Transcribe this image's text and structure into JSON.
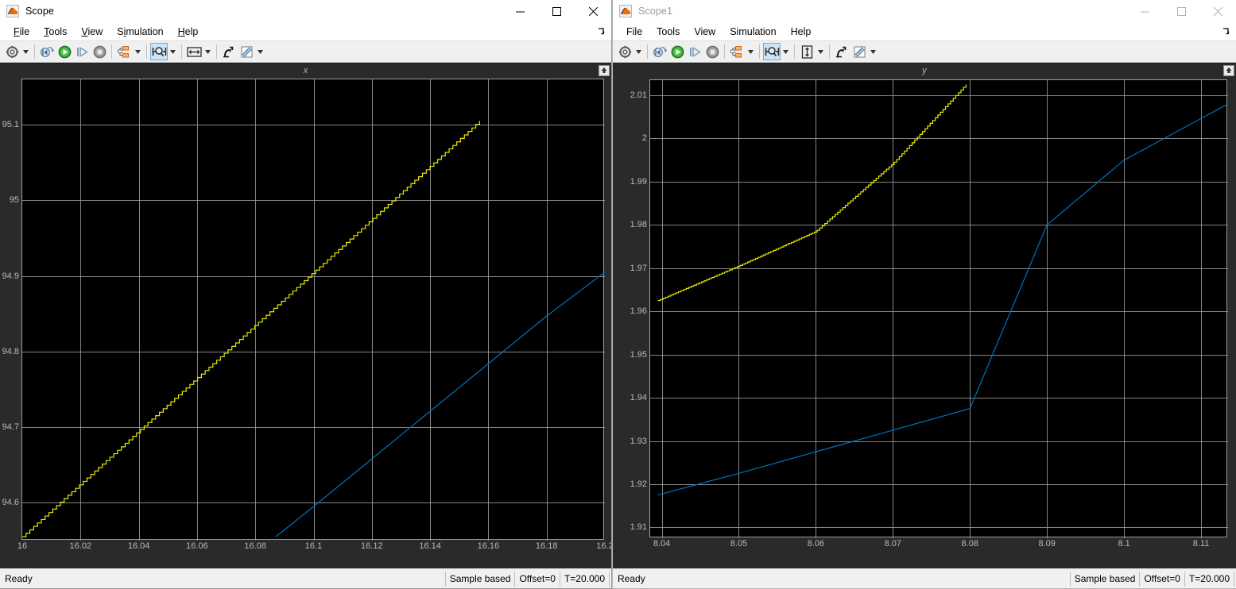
{
  "windows": [
    {
      "id": "scope",
      "title": "Scope",
      "active": true,
      "icon": "matlab-scope-icon",
      "menus": [
        {
          "label": "File",
          "mnemonic": "F"
        },
        {
          "label": "Tools",
          "mnemonic": "T"
        },
        {
          "label": "View",
          "mnemonic": "V"
        },
        {
          "label": "Simulation",
          "mnemonic": "i"
        },
        {
          "label": "Help",
          "mnemonic": "H"
        }
      ],
      "toolbar": [
        {
          "name": "print-options-button",
          "icon": "gear-icon",
          "dropdown": true
        },
        {
          "sep": true
        },
        {
          "name": "run-back-to-start-button",
          "icon": "rewind-icon"
        },
        {
          "name": "run-button",
          "icon": "play-icon"
        },
        {
          "name": "step-forward-button",
          "icon": "step-forward-icon"
        },
        {
          "name": "stop-button",
          "icon": "stop-icon"
        },
        {
          "sep": true
        },
        {
          "name": "configuration-properties-button",
          "icon": "layout-icon",
          "dropdown": true
        },
        {
          "sep": true
        },
        {
          "name": "zoom-in-x-button",
          "icon": "zoom-x-icon",
          "dropdown": true,
          "active": true
        },
        {
          "sep": true
        },
        {
          "name": "scale-axes-limits-button",
          "icon": "fit-horizontal-icon",
          "dropdown": true
        },
        {
          "sep": true
        },
        {
          "name": "highlight-signal-button",
          "icon": "highlight-arrow-icon"
        },
        {
          "name": "cursor-measurements-button",
          "icon": "ruler-icon",
          "dropdown": true
        }
      ],
      "plot_title": "x",
      "status": {
        "ready": "Ready",
        "mode": "Sample based",
        "offset": "Offset=0",
        "time": "T=20.000"
      }
    },
    {
      "id": "scope1",
      "title": "Scope1",
      "active": false,
      "icon": "matlab-scope-icon",
      "menus": [
        {
          "label": "File",
          "mnemonic": ""
        },
        {
          "label": "Tools",
          "mnemonic": ""
        },
        {
          "label": "View",
          "mnemonic": ""
        },
        {
          "label": "Simulation",
          "mnemonic": ""
        },
        {
          "label": "Help",
          "mnemonic": ""
        }
      ],
      "toolbar": [
        {
          "name": "print-options-button",
          "icon": "gear-icon",
          "dropdown": true
        },
        {
          "sep": true
        },
        {
          "name": "run-back-to-start-button",
          "icon": "rewind-icon"
        },
        {
          "name": "run-button",
          "icon": "play-icon"
        },
        {
          "name": "step-forward-button",
          "icon": "step-forward-icon"
        },
        {
          "name": "stop-button",
          "icon": "stop-icon"
        },
        {
          "sep": true
        },
        {
          "name": "configuration-properties-button",
          "icon": "layout-icon",
          "dropdown": true
        },
        {
          "sep": true
        },
        {
          "name": "zoom-in-x-button",
          "icon": "zoom-x-icon",
          "dropdown": true,
          "active": true
        },
        {
          "sep": true
        },
        {
          "name": "scale-axes-limits-button",
          "icon": "fit-vertical-icon",
          "dropdown": true
        },
        {
          "sep": true
        },
        {
          "name": "highlight-signal-button",
          "icon": "highlight-arrow-icon"
        },
        {
          "name": "cursor-measurements-button",
          "icon": "ruler-icon",
          "dropdown": true
        }
      ],
      "plot_title": "y",
      "status": {
        "ready": "Ready",
        "mode": "Sample based",
        "offset": "Offset=0",
        "time": "T=20.000"
      }
    }
  ],
  "colors": {
    "plot_background": "#000000",
    "figure_background": "#2a2a2a",
    "grid": "#9d9d9d",
    "axis_text": "#b9b9b9",
    "series_yellow": "#e8e800",
    "series_blue": "#0072bd",
    "accent_toolbar_active": "#cce4f7"
  },
  "chart_data": [
    {
      "id": "scope-x",
      "type": "line",
      "title": "x",
      "xlabel": "",
      "ylabel": "",
      "grid": true,
      "legend": "none",
      "xlim": [
        16.0,
        16.2
      ],
      "ylim": [
        94.55,
        95.16
      ],
      "xticks": [
        16,
        16.02,
        16.04,
        16.06,
        16.08,
        16.1,
        16.12,
        16.14,
        16.16,
        16.18,
        16.2
      ],
      "xticklabels": [
        "16",
        "16.02",
        "16.04",
        "16.06",
        "16.08",
        "16.1",
        "16.12",
        "16.14",
        "16.16",
        "16.18",
        "16.2"
      ],
      "yticks": [
        94.6,
        94.7,
        94.8,
        94.9,
        95,
        95.1
      ],
      "yticklabels": [
        "94.6",
        "94.7",
        "94.8",
        "94.9",
        "95",
        "95.1"
      ],
      "series": [
        {
          "name": "staircase-yellow",
          "color": "#e8e800",
          "style": "staircase",
          "x": [
            16.0,
            16.02,
            16.04,
            16.06,
            16.08,
            16.1,
            16.12,
            16.14,
            16.157
          ],
          "y": [
            94.555,
            94.625,
            94.695,
            94.765,
            94.835,
            94.905,
            94.975,
            95.045,
            95.105
          ]
        },
        {
          "name": "smooth-blue",
          "color": "#0072bd",
          "style": "line",
          "x": [
            16.087,
            16.1,
            16.12,
            16.14,
            16.16,
            16.18,
            16.2
          ],
          "y": [
            94.555,
            94.595,
            94.658,
            94.721,
            94.784,
            94.847,
            94.905
          ]
        }
      ]
    },
    {
      "id": "scope1-y",
      "type": "line",
      "title": "y",
      "xlabel": "",
      "ylabel": "",
      "grid": true,
      "legend": "none",
      "xlim": [
        8.0385,
        8.1135
      ],
      "ylim": [
        1.9075,
        2.0135
      ],
      "xticks": [
        8.04,
        8.05,
        8.06,
        8.07,
        8.08,
        8.09,
        8.1,
        8.11
      ],
      "xticklabels": [
        "8.04",
        "8.05",
        "8.06",
        "8.07",
        "8.08",
        "8.09",
        "8.1",
        "8.11"
      ],
      "yticks": [
        1.91,
        1.92,
        1.93,
        1.94,
        1.95,
        1.96,
        1.97,
        1.98,
        1.99,
        2,
        2.01
      ],
      "yticklabels": [
        "1.91",
        "1.92",
        "1.93",
        "1.94",
        "1.95",
        "1.96",
        "1.97",
        "1.98",
        "1.99",
        "2",
        "2.01"
      ],
      "series": [
        {
          "name": "staircase-yellow",
          "color": "#e8e800",
          "style": "staircase",
          "x": [
            8.0395,
            8.05,
            8.06,
            8.07,
            8.0795
          ],
          "y": [
            1.9625,
            1.9705,
            1.9785,
            1.9942,
            2.0125
          ]
        },
        {
          "name": "smooth-blue",
          "color": "#0072bd",
          "style": "line",
          "x": [
            8.0395,
            8.05,
            8.06,
            8.07,
            8.08,
            8.09,
            8.1,
            8.1135
          ],
          "y": [
            1.9175,
            1.9225,
            1.9275,
            1.9325,
            1.9375,
            1.98,
            1.995,
            2.008
          ]
        }
      ]
    }
  ]
}
